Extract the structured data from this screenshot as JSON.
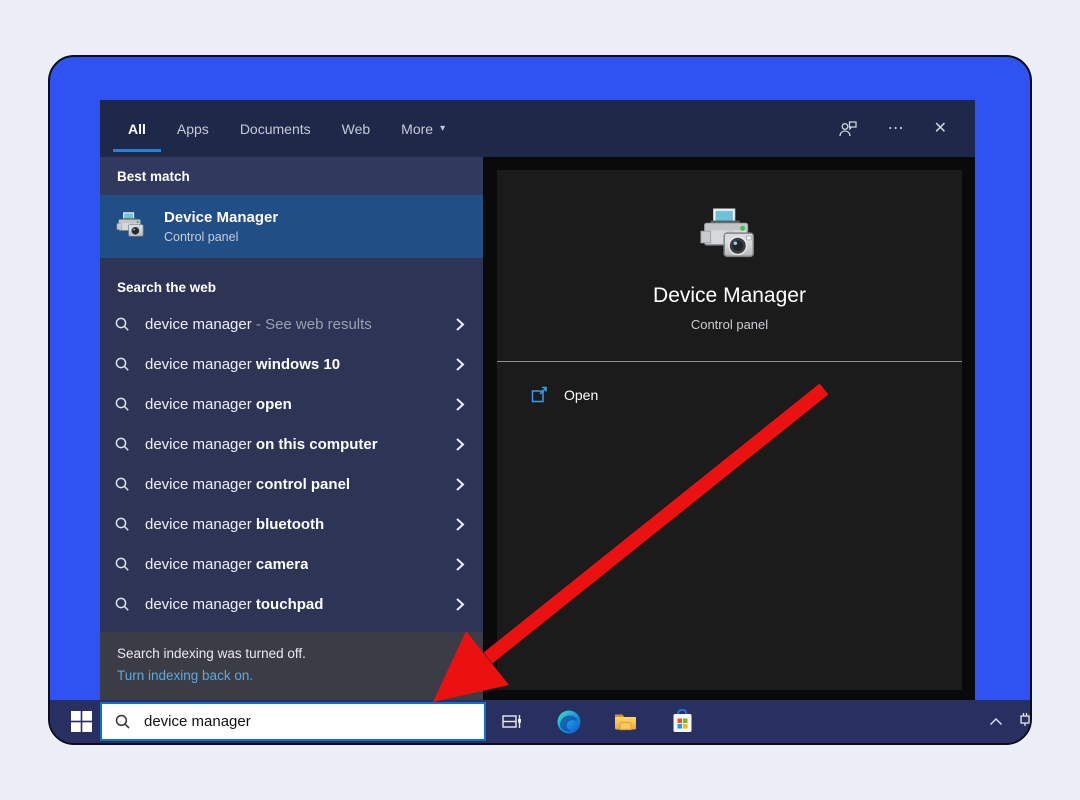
{
  "tabs": {
    "items": [
      {
        "label": "All",
        "active": true
      },
      {
        "label": "Apps"
      },
      {
        "label": "Documents"
      },
      {
        "label": "Web"
      },
      {
        "label": "More",
        "caret": "▾"
      }
    ]
  },
  "glyphs": {
    "ellipsis": "⋯",
    "close": "✕"
  },
  "best_match": {
    "header": "Best match",
    "title": "Device Manager",
    "subtitle": "Control panel"
  },
  "web_search": {
    "header": "Search the web",
    "items": [
      {
        "prefix": "device manager",
        "annotation": " - See web results"
      },
      {
        "prefix": "device manager",
        "suffix": " windows 10"
      },
      {
        "prefix": "device manager",
        "suffix": " open"
      },
      {
        "prefix": "device manager",
        "suffix": " on this computer"
      },
      {
        "prefix": "device manager",
        "suffix": " control panel"
      },
      {
        "prefix": "device manager",
        "suffix": " bluetooth"
      },
      {
        "prefix": "device manager",
        "suffix": " camera"
      },
      {
        "prefix": "device manager",
        "suffix": " touchpad"
      }
    ]
  },
  "notice": {
    "line1": "Search indexing was turned off.",
    "line2": "Turn indexing back on."
  },
  "preview": {
    "title": "Device Manager",
    "subtitle": "Control panel",
    "open_label": "Open"
  },
  "taskbar": {
    "search_value": "device manager"
  },
  "colors": {
    "frame_blue": "#2e53f2",
    "tabbar_navy": "#1e2949",
    "panel_navy": "#2d3456",
    "highlight_row": "#214e85",
    "notice_gray": "#3a3d45",
    "taskbar_navy": "#273060",
    "accent_underline": "#2c7dd3",
    "link_blue": "#61a8dc",
    "search_border": "#0f6ed4",
    "arrow_red": "#ec1111"
  }
}
